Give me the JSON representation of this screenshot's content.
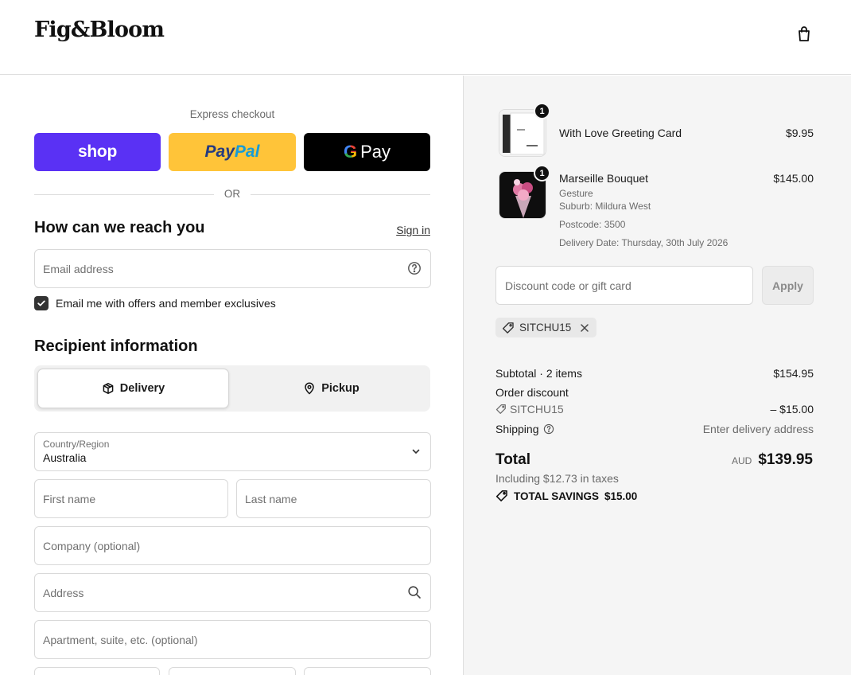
{
  "header": {
    "logo": "Fig&Bloom",
    "cart_icon": "shopping-bag-icon"
  },
  "express": {
    "title": "Express checkout",
    "shop_label": "shop",
    "paypal_label_a": "Pay",
    "paypal_label_b": "Pal",
    "gpay_g": "G",
    "gpay_label": "Pay",
    "or": "OR"
  },
  "contact": {
    "heading": "How can we reach you",
    "signin": "Sign in",
    "email_placeholder": "Email address",
    "email_icon": "help-circle-icon",
    "marketing_label": "Email me with offers and member exclusives",
    "marketing_checked": true
  },
  "recipient": {
    "heading": "Recipient information",
    "tabs": [
      {
        "label": "Delivery",
        "icon": "box-icon",
        "selected": true
      },
      {
        "label": "Pickup",
        "icon": "location-pin-icon",
        "selected": false
      }
    ],
    "country_label": "Country/Region",
    "country_value": "Australia",
    "first_name": "First name",
    "last_name": "Last name",
    "company": "Company (optional)",
    "address": "Address",
    "apartment": "Apartment, suite, etc. (optional)"
  },
  "order": {
    "items": [
      {
        "name": "With Love Greeting Card",
        "price": "$9.95",
        "qty": "1"
      },
      {
        "name": "Marseille Bouquet",
        "price": "$145.00",
        "qty": "1",
        "meta": [
          "Gesture",
          "Suburb: Mildura West",
          "Postcode: 3500",
          "Delivery Date: Thursday, 30th July 2026"
        ]
      }
    ],
    "discount_placeholder": "Discount code or gift card",
    "apply_label": "Apply",
    "applied_code": "SITCHU15",
    "subtotal_label": "Subtotal · 2 items",
    "subtotal_value": "$154.95",
    "order_discount_label": "Order discount",
    "discount_code": "SITCHU15",
    "discount_value": "– $15.00",
    "shipping_label": "Shipping",
    "shipping_value": "Enter delivery address",
    "total_label": "Total",
    "currency": "AUD",
    "total_value": "$139.95",
    "tax_line": "Including $12.73 in taxes",
    "savings_label": "TOTAL SAVINGS",
    "savings_value": "$15.00"
  },
  "colors": {
    "shop": "#5a31f4",
    "paypal": "#ffc439",
    "gpay": "#000000",
    "summary_bg": "#f5f5f5"
  }
}
